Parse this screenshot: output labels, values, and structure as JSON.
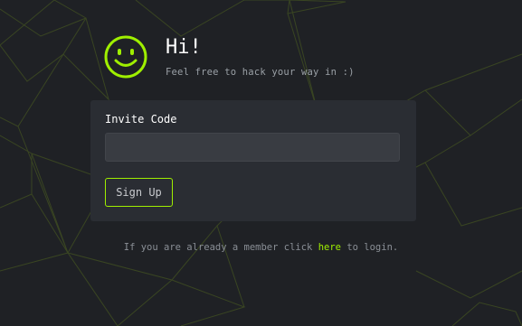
{
  "header": {
    "greeting": "Hi!",
    "subtitle": "Feel free to hack your way in :)",
    "icon": "smiley-icon"
  },
  "form": {
    "invite_label": "Invite Code",
    "invite_value": "",
    "invite_placeholder": "",
    "signup_label": "Sign Up"
  },
  "footer": {
    "text_before": "If you are already a member click ",
    "link_text": "here",
    "text_after": " to login."
  },
  "colors": {
    "background": "#1f2125",
    "card": "#2a2d33",
    "input": "#393c42",
    "accent": "#9fef00",
    "network_lines": "#4a5a1c"
  }
}
